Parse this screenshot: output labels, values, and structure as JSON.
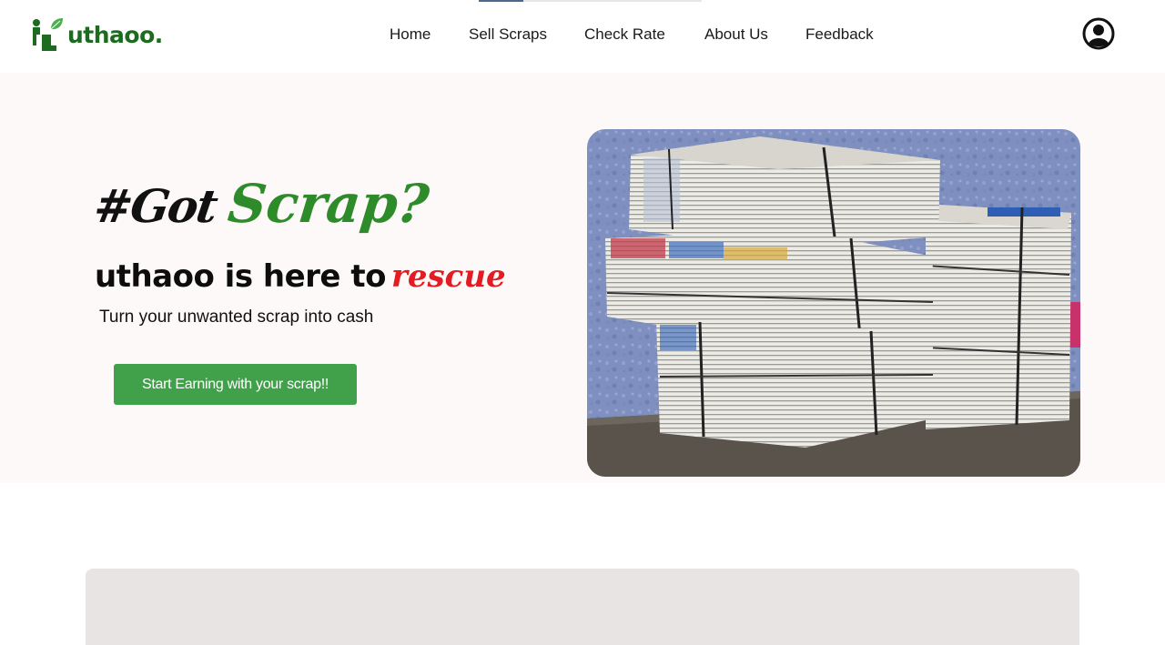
{
  "brand": {
    "name": "uthaoo.",
    "color": "#1d6b1f"
  },
  "nav": {
    "items": [
      {
        "label": "Home"
      },
      {
        "label": "Sell Scraps"
      },
      {
        "label": "Check Rate"
      },
      {
        "label": "About Us"
      },
      {
        "label": "Feedback"
      }
    ],
    "account_icon": "user-circle-icon"
  },
  "hero": {
    "title_part1": "#Got",
    "title_part2": "Scrap?",
    "headline_main": "uthaoo is here to",
    "headline_accent": "rescue",
    "subtitle": "Turn your unwanted scrap into cash",
    "cta_label": "Start Earning with your scrap!!",
    "accent_green": "#2e8b2a",
    "accent_red": "#e31b23",
    "button_color": "#41a04a"
  }
}
